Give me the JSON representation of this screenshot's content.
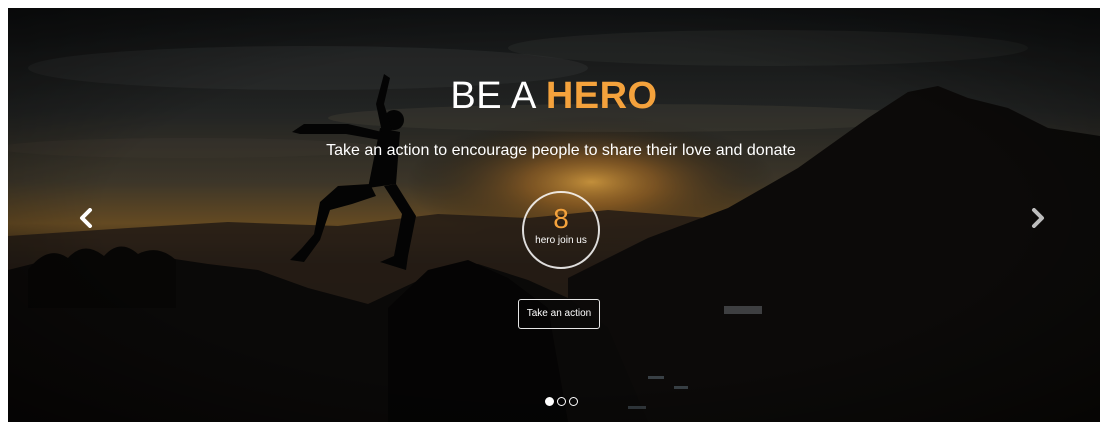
{
  "hero": {
    "title_main": "BE A",
    "title_accent": "HERO",
    "subtitle": "Take an action to encourage people to share their love and donate"
  },
  "counter": {
    "value": "8",
    "label": "hero join us"
  },
  "cta": {
    "label": "Take an action"
  },
  "carousel": {
    "slide_count": 3,
    "active_index": 0,
    "prev_icon": "chevron-left-icon",
    "next_icon": "chevron-right-icon"
  },
  "colors": {
    "accent": "#f4a23c",
    "text": "#ffffff"
  }
}
